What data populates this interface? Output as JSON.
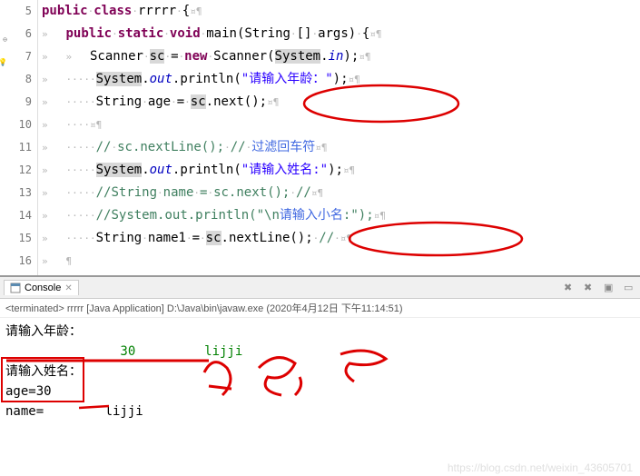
{
  "editor": {
    "lines": [
      {
        "num": "5",
        "marker": "",
        "tokens": [
          [
            "kw",
            "public"
          ],
          [
            "ws",
            "·"
          ],
          [
            "kw",
            "class"
          ],
          [
            "ws",
            "·"
          ],
          [
            "type",
            "rrrrr"
          ],
          [
            "ws",
            "·"
          ],
          [
            "",
            "{"
          ],
          [
            "ws",
            "¤¶"
          ]
        ]
      },
      {
        "num": "6",
        "marker": "⊖",
        "tokens": [
          [
            "ws",
            "»   "
          ],
          [
            "kw",
            "public"
          ],
          [
            "ws",
            "·"
          ],
          [
            "kw",
            "static"
          ],
          [
            "ws",
            "·"
          ],
          [
            "kw",
            "void"
          ],
          [
            "ws",
            "·"
          ],
          [
            "",
            "main(String"
          ],
          [
            "ws",
            "·"
          ],
          [
            "",
            "[]"
          ],
          [
            "ws",
            "·"
          ],
          [
            "",
            "args)"
          ],
          [
            "ws",
            "·"
          ],
          [
            "",
            "{"
          ],
          [
            "ws",
            "¤¶"
          ]
        ]
      },
      {
        "num": "7",
        "marker": "💡",
        "tokens": [
          [
            "ws",
            "»   »   "
          ],
          [
            "",
            "Scanner"
          ],
          [
            "ws",
            "·"
          ],
          [
            "hl",
            "sc"
          ],
          [
            "ws",
            "·"
          ],
          [
            "",
            "="
          ],
          [
            "ws",
            "·"
          ],
          [
            "kw",
            "new"
          ],
          [
            "ws",
            "·"
          ],
          [
            "",
            "Scanner("
          ],
          [
            "hl",
            "System"
          ],
          [
            "",
            "."
          ],
          [
            "field",
            "in"
          ],
          [
            "",
            ");"
          ],
          [
            "ws",
            "¤¶"
          ]
        ]
      },
      {
        "num": "8",
        "marker": "",
        "tokens": [
          [
            "ws",
            "»   ·····"
          ],
          [
            "hl",
            "System"
          ],
          [
            "",
            "."
          ],
          [
            "field",
            "out"
          ],
          [
            "",
            ".println("
          ],
          [
            "str",
            "\"请输入年龄：\""
          ],
          [
            "",
            ");"
          ],
          [
            "ws",
            "¤¶"
          ]
        ]
      },
      {
        "num": "9",
        "marker": "",
        "tokens": [
          [
            "ws",
            "»   ·····"
          ],
          [
            "",
            "String"
          ],
          [
            "ws",
            "·"
          ],
          [
            "",
            "age"
          ],
          [
            "ws",
            "·"
          ],
          [
            "",
            "="
          ],
          [
            "ws",
            "·"
          ],
          [
            "hl",
            "sc"
          ],
          [
            "",
            ".next();"
          ],
          [
            "ws",
            "¤¶"
          ]
        ]
      },
      {
        "num": "10",
        "marker": "",
        "tokens": [
          [
            "ws",
            "»   ····¤¶"
          ]
        ]
      },
      {
        "num": "11",
        "marker": "",
        "tokens": [
          [
            "ws",
            "»   ·····"
          ],
          [
            "comment",
            "//"
          ],
          [
            "ws",
            "·"
          ],
          [
            "comment",
            "sc.nextLine();"
          ],
          [
            "ws",
            "·"
          ],
          [
            "comment",
            "//"
          ],
          [
            "ws",
            "·"
          ],
          [
            "comment-cn",
            "过滤回车符"
          ],
          [
            "ws",
            "¤¶"
          ]
        ]
      },
      {
        "num": "12",
        "marker": "",
        "tokens": [
          [
            "ws",
            "»   ·····"
          ],
          [
            "hl",
            "System"
          ],
          [
            "",
            "."
          ],
          [
            "field",
            "out"
          ],
          [
            "",
            ".println("
          ],
          [
            "str",
            "\"请输入姓名:\""
          ],
          [
            "",
            ");"
          ],
          [
            "ws",
            "¤¶"
          ]
        ]
      },
      {
        "num": "13",
        "marker": "",
        "tokens": [
          [
            "ws",
            "»   ·····"
          ],
          [
            "comment",
            "//String"
          ],
          [
            "ws",
            "·"
          ],
          [
            "comment",
            "name"
          ],
          [
            "ws",
            "·"
          ],
          [
            "comment",
            "="
          ],
          [
            "ws",
            "·"
          ],
          [
            "comment",
            "sc.next();"
          ],
          [
            "ws",
            "·"
          ],
          [
            "comment",
            "//"
          ],
          [
            "ws",
            "¤¶"
          ]
        ]
      },
      {
        "num": "14",
        "marker": "",
        "tokens": [
          [
            "ws",
            "»   ·····"
          ],
          [
            "comment",
            "//System.out.println(\"\\n"
          ],
          [
            "comment-cn",
            "请输入小名"
          ],
          [
            "comment",
            ":\");"
          ],
          [
            "ws",
            "¤¶"
          ]
        ]
      },
      {
        "num": "15",
        "marker": "",
        "tokens": [
          [
            "ws",
            "»   ·····"
          ],
          [
            "",
            "String"
          ],
          [
            "ws",
            "·"
          ],
          [
            "",
            "name1"
          ],
          [
            "ws",
            "·"
          ],
          [
            "",
            "="
          ],
          [
            "ws",
            "·"
          ],
          [
            "hl",
            "sc"
          ],
          [
            "",
            ".nextLine();"
          ],
          [
            "ws",
            "·"
          ],
          [
            "comment",
            "//"
          ],
          [
            "ws",
            "·"
          ],
          [
            "ws",
            "¤¶"
          ]
        ]
      },
      {
        "num": "16",
        "marker": "",
        "tokens": [
          [
            "ws",
            "»   ¶"
          ]
        ]
      }
    ]
  },
  "console": {
    "tab_label": "Console",
    "info": "<terminated> rrrrr [Java Application] D:\\Java\\bin\\javaw.exe (2020年4月12日 下午11:14:51)",
    "output": [
      {
        "t": "请输入年龄：",
        "cls": ""
      },
      {
        "t": "               30         lijji",
        "cls": "out-green"
      },
      {
        "t": "请输入姓名：",
        "cls": ""
      },
      {
        "t": "age=30",
        "cls": ""
      },
      {
        "t": "name=        lijji",
        "cls": ""
      }
    ]
  },
  "watermark": "https://blog.csdn.net/weixin_43605701"
}
